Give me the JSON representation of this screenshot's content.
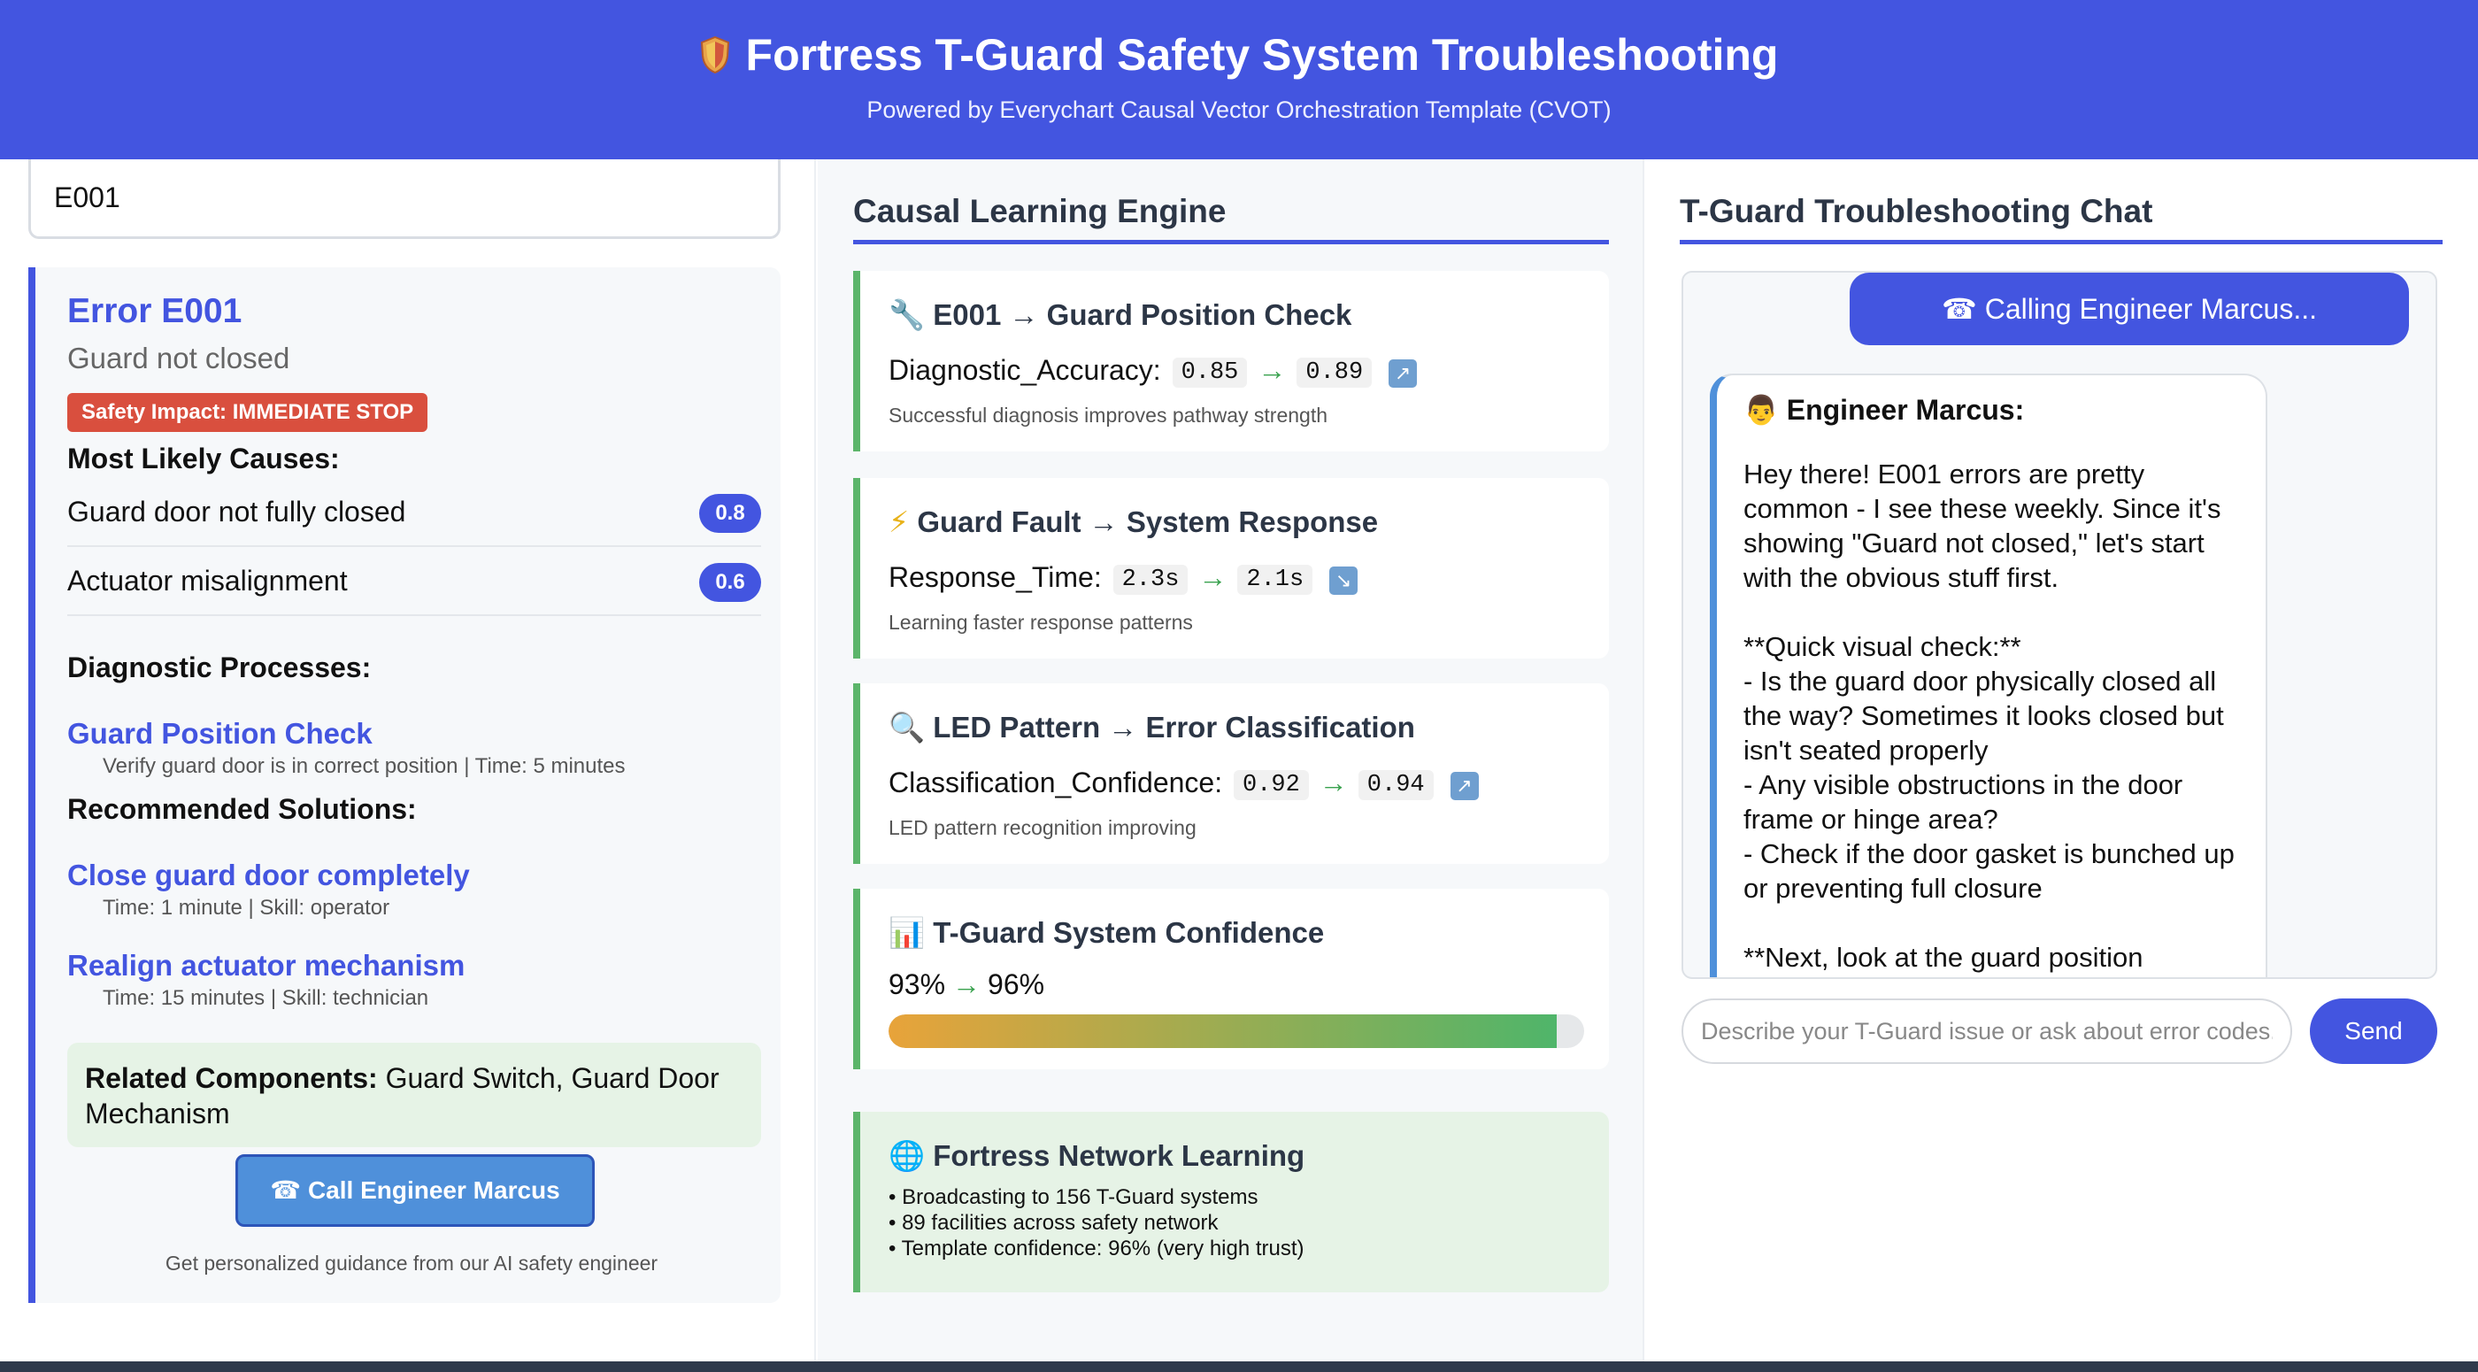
{
  "header": {
    "title": "Fortress T-Guard Safety System Troubleshooting",
    "subtitle": "Powered by Everychart Causal Vector Orchestration Template (CVOT)"
  },
  "left": {
    "search_value": "E001",
    "error": {
      "title": "Error E001",
      "description": "Guard not closed",
      "impact_badge": "Safety Impact: IMMEDIATE STOP"
    },
    "causes_heading": "Most Likely Causes:",
    "causes": [
      {
        "label": "Guard door not fully closed",
        "score": "0.8"
      },
      {
        "label": "Actuator misalignment",
        "score": "0.6"
      }
    ],
    "processes_heading": "Diagnostic Processes:",
    "processes": [
      {
        "title": "Guard Position Check",
        "meta": "Verify guard door is in correct position | Time: 5 minutes"
      }
    ],
    "solutions_heading": "Recommended Solutions:",
    "solutions": [
      {
        "title": "Close guard door completely",
        "meta": "Time: 1 minute | Skill: operator"
      },
      {
        "title": "Realign actuator mechanism",
        "meta": "Time: 15 minutes | Skill: technician"
      }
    ],
    "related_label": "Related Components:",
    "related_value": "Guard Switch, Guard Door Mechanism",
    "call_button": "Call Engineer Marcus",
    "call_caption": "Get personalized guidance from our AI safety engineer"
  },
  "middle": {
    "heading": "Causal Learning Engine",
    "cards": [
      {
        "icon": "wrench-icon",
        "title": "E001 → Guard Position Check",
        "metric": "Diagnostic_Accuracy:",
        "from": "0.85",
        "to": "0.89",
        "trend": "up",
        "note": "Successful diagnosis improves pathway strength"
      },
      {
        "icon": "lightning-icon",
        "title": "Guard Fault → System Response",
        "metric": "Response_Time:",
        "from": "2.3s",
        "to": "2.1s",
        "trend": "down",
        "note": "Learning faster response patterns"
      },
      {
        "icon": "magnifier-icon",
        "title": "LED Pattern → Error Classification",
        "metric": "Classification_Confidence:",
        "from": "0.92",
        "to": "0.94",
        "trend": "up",
        "note": "LED pattern recognition improving"
      }
    ],
    "confidence": {
      "title": "T-Guard System Confidence",
      "from": "93%",
      "to": "96%",
      "level": 0.96
    },
    "network": {
      "title": "Fortress Network Learning",
      "items": [
        "• Broadcasting to 156 T-Guard systems",
        "• 89 facilities across safety network",
        "• Template confidence: 96% (very high trust)"
      ]
    }
  },
  "right": {
    "heading": "T-Guard Troubleshooting Chat",
    "calling_status": "Calling Engineer Marcus...",
    "message_author": "Engineer Marcus:",
    "message_text": "Hey there! E001 errors are pretty common - I see these weekly. Since it's showing \"Guard not closed,\" let's start with the obvious stuff first.\n\n**Quick visual check:**\n- Is the guard door physically closed all the way? Sometimes it looks closed but isn't seated properly\n- Any visible obstructions in the door frame or hinge area?\n- Check if the door gasket is bunched up or preventing full closure\n\n**Next, look at the guard position",
    "input_placeholder": "Describe your T-Guard issue or ask about error codes...",
    "send_label": "Send"
  },
  "colors": {
    "brand": "#4355e0",
    "danger": "#d94f3e",
    "success": "#5cb56a",
    "call_button": "#4f90da"
  }
}
